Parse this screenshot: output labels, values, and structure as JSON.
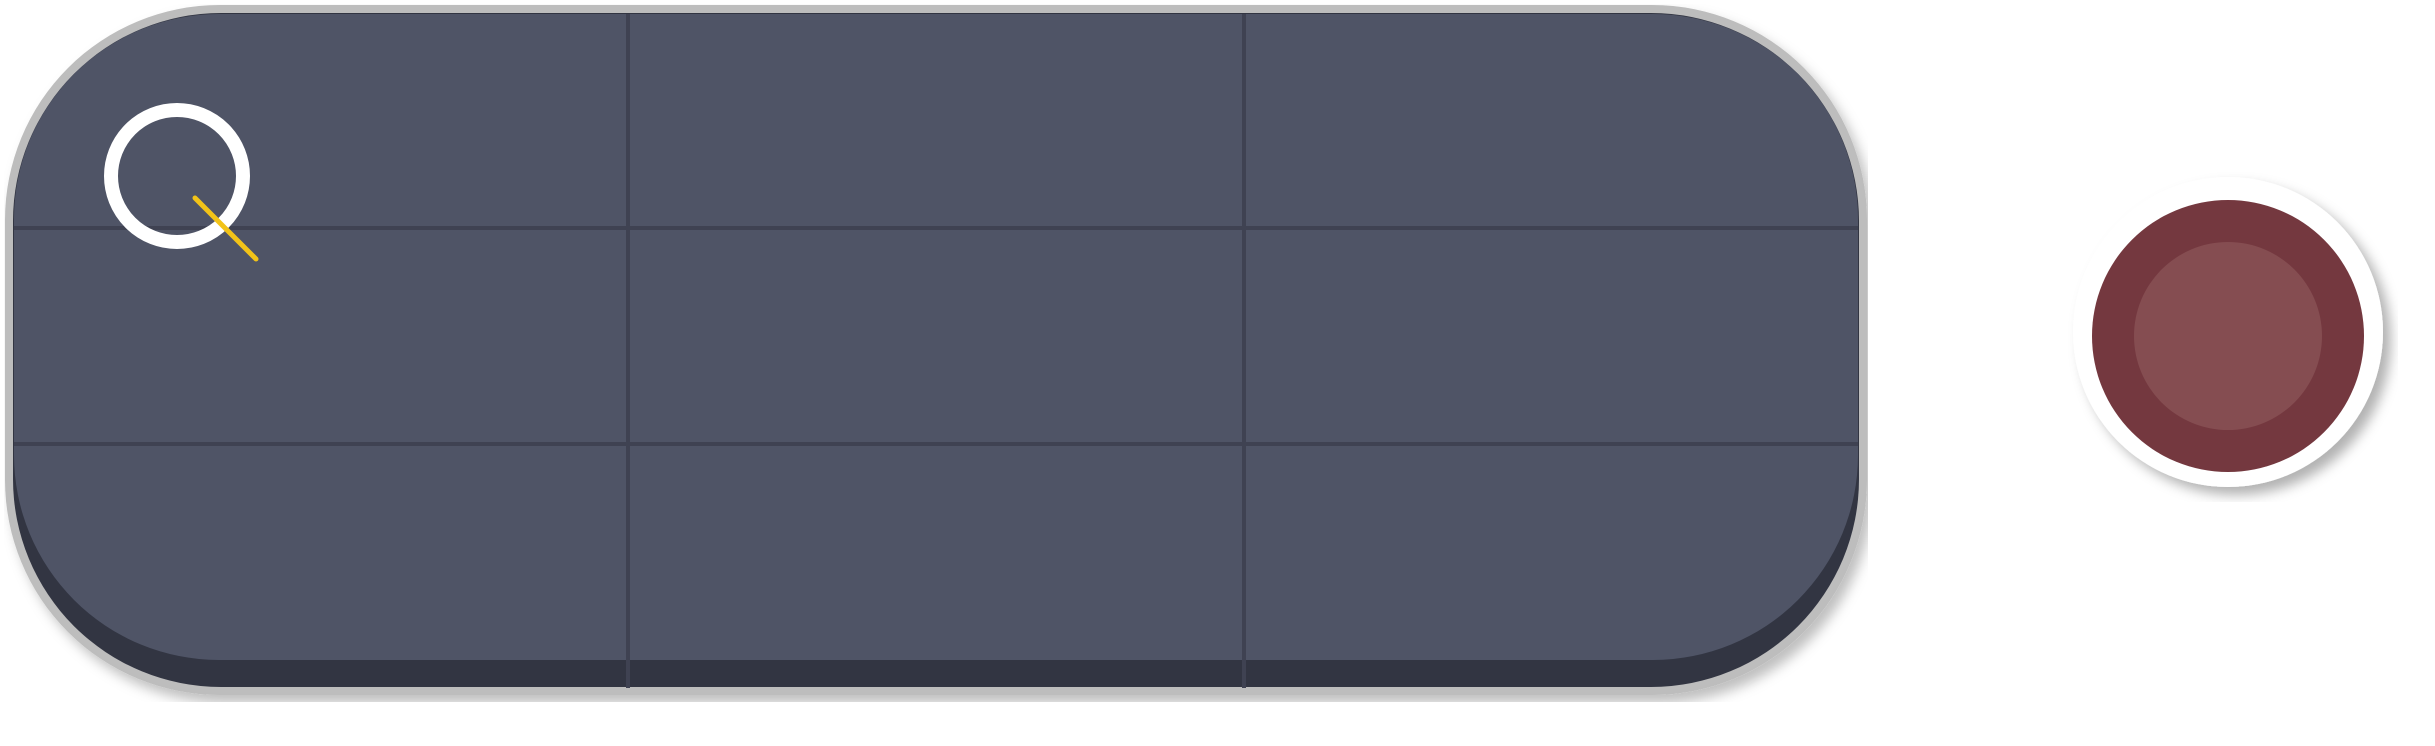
{
  "search": {
    "icon": "search-icon",
    "value": ""
  },
  "record": {
    "icon": "record-icon",
    "state": "idle"
  },
  "colors": {
    "panel": "#4f5466",
    "panel_shadow": "#323542",
    "panel_border": "#bdbdbd",
    "grid_line": "#3f4252",
    "icon_ring": "#ffffff",
    "icon_handle": "#f2c318",
    "record_outer": "#ffffff",
    "record_ring": "#74383f",
    "record_core": "#854d51"
  }
}
